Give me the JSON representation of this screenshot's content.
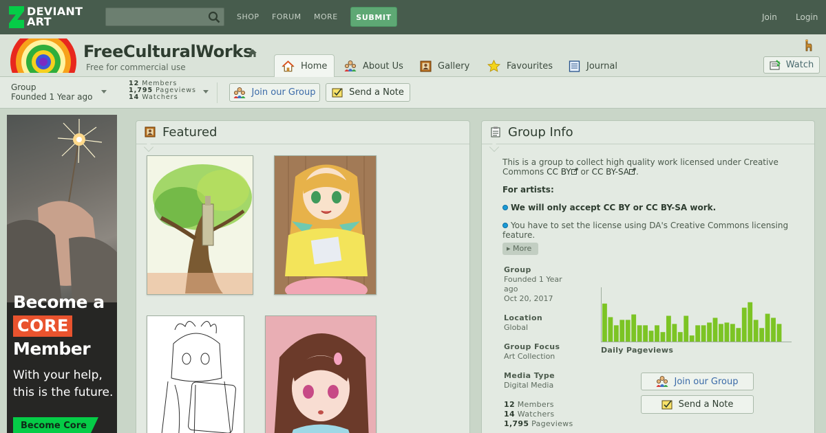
{
  "topnav": {
    "logo_line1": "DEVIANT",
    "logo_line2": "ART",
    "search_placeholder": "",
    "links": [
      "SHOP",
      "FORUM",
      "MORE"
    ],
    "submit_label": "SUBMIT",
    "join_label": "Join",
    "login_label": "Login"
  },
  "group": {
    "name": "FreeCulturalWorks",
    "tagline": "Free for commercial use",
    "tabs": [
      {
        "label": "Home",
        "icon": "home-icon"
      },
      {
        "label": "About Us",
        "icon": "people-icon"
      },
      {
        "label": "Gallery",
        "icon": "gallery-icon"
      },
      {
        "label": "Favourites",
        "icon": "star-icon"
      },
      {
        "label": "Journal",
        "icon": "journal-icon"
      }
    ],
    "watch_label": "Watch"
  },
  "infobar": {
    "type": "Group",
    "founded": "Founded 1 Year ago",
    "members_num": "12",
    "members_label": "Members",
    "pageviews_num": "1,795",
    "pageviews_label": "Pageviews",
    "watchers_num": "14",
    "watchers_label": "Watchers",
    "join_label": "Join our Group",
    "note_label": "Send a Note"
  },
  "ad": {
    "line1": "Become a",
    "core": "CORE",
    "line2": "Member",
    "line3": "With your help, this is the future.",
    "button": "Become Core"
  },
  "featured": {
    "title": "Featured"
  },
  "groupinfo": {
    "title": "Group Info",
    "intro_a": "This is a group to collect high quality work licensed under Creative Commons",
    "cc_by": "CC BY",
    "or": "or",
    "cc_bysa": "CC BY-SA",
    "period": ".",
    "for_artists": "For artists:",
    "rule1": "We will only accept CC BY or CC BY-SA work.",
    "rule2": "You have to set the license using DA's Creative Commons licensing feature.",
    "more": "More",
    "fields": {
      "group_label": "Group",
      "group_val1": "Founded 1 Year",
      "group_val2": "ago",
      "group_val3": "Oct 20, 2017",
      "location_label": "Location",
      "location_val": "Global",
      "focus_label": "Group Focus",
      "focus_val": "Art Collection",
      "media_label": "Media Type",
      "media_val": "Digital Media"
    },
    "chart_caption": "Daily Pageviews",
    "join_label": "Join our Group",
    "note_label": "Send a Note",
    "stats": {
      "members_num": "12",
      "members_label": "Members",
      "watchers_num": "14",
      "watchers_label": "Watchers",
      "pageviews_num": "1,795",
      "pageviews_label": "Pageviews"
    }
  },
  "chart_data": {
    "type": "bar",
    "title": "",
    "xlabel": "Daily Pageviews",
    "ylabel": "",
    "values": [
      56,
      36,
      24,
      32,
      32,
      40,
      24,
      24,
      16,
      24,
      14,
      38,
      26,
      14,
      38,
      9,
      24,
      24,
      28,
      35,
      26,
      28,
      26,
      20,
      50,
      58,
      32,
      20,
      41,
      35,
      26
    ],
    "ylim": [
      0,
      80
    ],
    "grid": false,
    "colors": {
      "bar": "#7cc424"
    }
  }
}
